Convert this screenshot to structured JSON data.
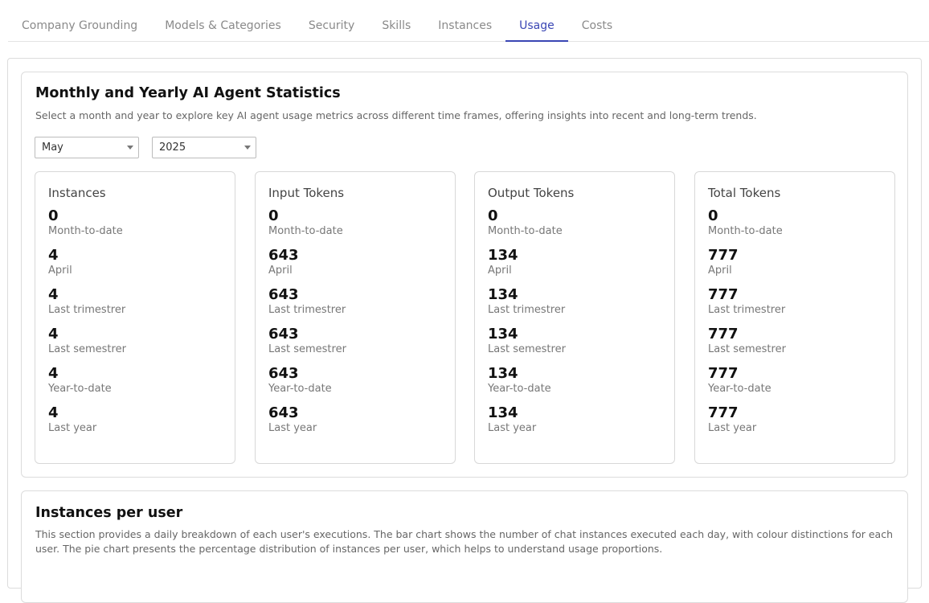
{
  "tabs": [
    {
      "label": "Company Grounding"
    },
    {
      "label": "Models & Categories"
    },
    {
      "label": "Security"
    },
    {
      "label": "Skills"
    },
    {
      "label": "Instances"
    },
    {
      "label": "Usage"
    },
    {
      "label": "Costs"
    }
  ],
  "active_tab": "Usage",
  "stats_section": {
    "title": "Monthly and Yearly AI Agent Statistics",
    "description": "Select a month and year to explore key AI agent usage metrics across different time frames, offering insights into recent and long-term trends.",
    "month_select": "May",
    "year_select": "2025",
    "cards": [
      {
        "title": "Instances",
        "stats": [
          {
            "value": "0",
            "label": "Month-to-date"
          },
          {
            "value": "4",
            "label": "April"
          },
          {
            "value": "4",
            "label": "Last trimestrer"
          },
          {
            "value": "4",
            "label": "Last semestrer"
          },
          {
            "value": "4",
            "label": "Year-to-date"
          },
          {
            "value": "4",
            "label": "Last year"
          }
        ]
      },
      {
        "title": "Input Tokens",
        "stats": [
          {
            "value": "0",
            "label": "Month-to-date"
          },
          {
            "value": "643",
            "label": "April"
          },
          {
            "value": "643",
            "label": "Last trimestrer"
          },
          {
            "value": "643",
            "label": "Last semestrer"
          },
          {
            "value": "643",
            "label": "Year-to-date"
          },
          {
            "value": "643",
            "label": "Last year"
          }
        ]
      },
      {
        "title": "Output Tokens",
        "stats": [
          {
            "value": "0",
            "label": "Month-to-date"
          },
          {
            "value": "134",
            "label": "April"
          },
          {
            "value": "134",
            "label": "Last trimestrer"
          },
          {
            "value": "134",
            "label": "Last semestrer"
          },
          {
            "value": "134",
            "label": "Year-to-date"
          },
          {
            "value": "134",
            "label": "Last year"
          }
        ]
      },
      {
        "title": "Total Tokens",
        "stats": [
          {
            "value": "0",
            "label": "Month-to-date"
          },
          {
            "value": "777",
            "label": "April"
          },
          {
            "value": "777",
            "label": "Last trimestrer"
          },
          {
            "value": "777",
            "label": "Last semestrer"
          },
          {
            "value": "777",
            "label": "Year-to-date"
          },
          {
            "value": "777",
            "label": "Last year"
          }
        ]
      }
    ]
  },
  "instances_section": {
    "title": "Instances per user",
    "description": "This section provides a daily breakdown of each user's executions. The bar chart shows the number of chat instances executed each day, with colour distinctions for each user. The pie chart presents the percentage distribution of instances per user, which helps to understand usage proportions."
  },
  "colors": {
    "accent": "#3a46b4",
    "border": "#dcdcdc",
    "muted_text": "#777777"
  }
}
